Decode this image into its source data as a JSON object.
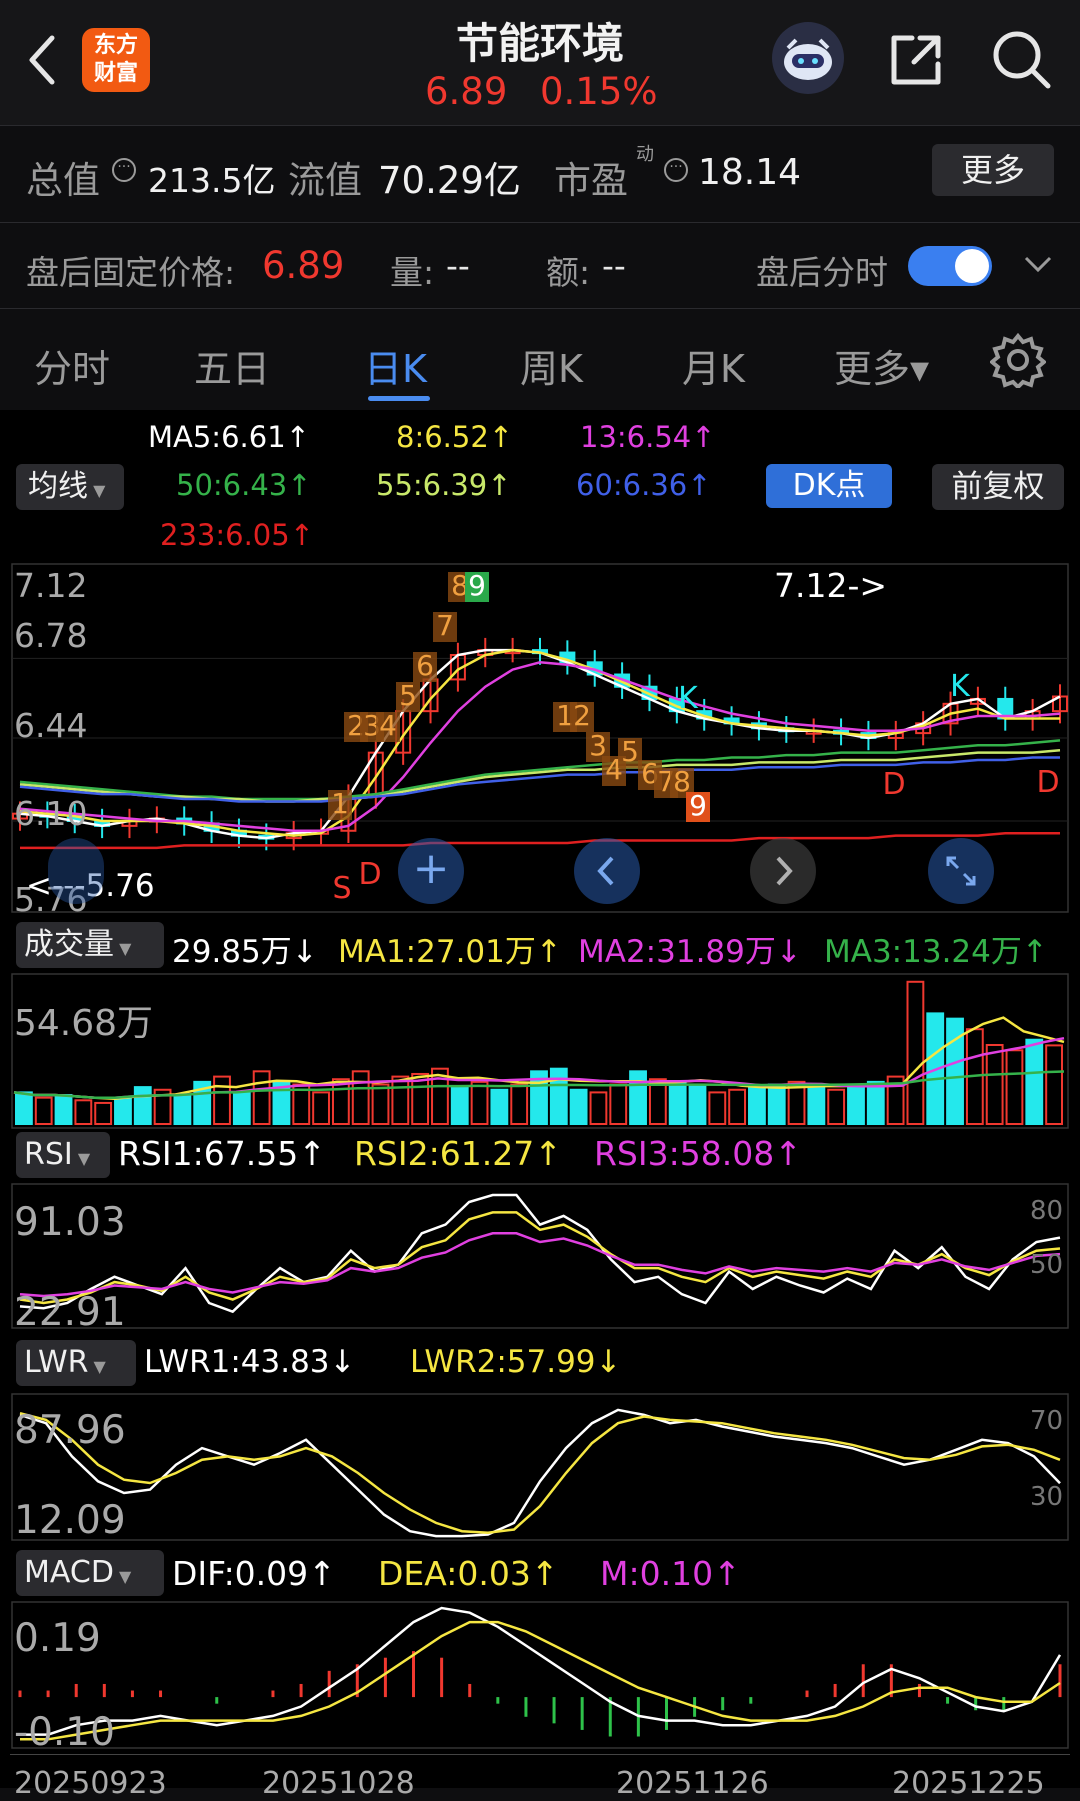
{
  "header": {
    "back_icon": "chevron-left-icon",
    "logo_line1": "东方",
    "logo_line2": "财富",
    "title": "节能环境",
    "price": "6.89",
    "change_pct": "0.15%",
    "icons": [
      "robot-avatar-icon",
      "share-icon",
      "search-icon"
    ]
  },
  "stats": {
    "total_label": "总值",
    "total_value": "213.5亿",
    "float_label": "流值",
    "float_value": "70.29亿",
    "pe_label": "市盈",
    "pe_sup": "动",
    "pe_value": "18.14",
    "more_button": "更多"
  },
  "after_hours": {
    "label": "盘后固定价格:",
    "price": "6.89",
    "vol_label": "量:",
    "vol_value": "--",
    "amt_label": "额:",
    "amt_value": "--",
    "toggle_label": "盘后分时",
    "toggle_on": true
  },
  "tabs": [
    "分时",
    "五日",
    "日K",
    "周K",
    "月K",
    "更多▾"
  ],
  "active_tab": "日K",
  "ma": {
    "selector": "均线",
    "ma5": "MA5:6.61↑",
    "ma8": "8:6.52↑",
    "ma13": "13:6.54↑",
    "ma50": "50:6.43↑",
    "ma55": "55:6.39↑",
    "ma60": "60:6.36↑",
    "ma233": "233:6.05↑",
    "dk_button": "DK点",
    "adjust_button": "前复权"
  },
  "kline": {
    "y_labels": [
      "7.12",
      "6.78",
      "6.44",
      "6.10",
      "5.76"
    ],
    "high_note": "7.12->",
    "low_note": "<---5.76",
    "td_up": [
      "1",
      "2",
      "3",
      "4",
      "5",
      "6",
      "7",
      "8",
      "9"
    ],
    "td_down": [
      "1",
      "2",
      "3",
      "4",
      "5",
      "6",
      "7",
      "8",
      "9"
    ],
    "markers": [
      "S",
      "D",
      "K",
      "K",
      "D",
      "D"
    ]
  },
  "volume": {
    "selector": "成交量",
    "value": "29.85万↓",
    "ma1": "MA1:27.01万↑",
    "ma2": "MA2:31.89万↓",
    "ma3": "MA3:13.24万↑",
    "y_label": "54.68万"
  },
  "rsi": {
    "selector": "RSI",
    "rsi1": "RSI1:67.55↑",
    "rsi2": "RSI2:61.27↑",
    "rsi3": "RSI3:58.08↑",
    "y_top": "91.03",
    "y_bottom": "22.91",
    "level_80": "80",
    "level_50": "50"
  },
  "lwr": {
    "selector": "LWR",
    "lwr1": "LWR1:43.83↓",
    "lwr2": "LWR2:57.99↓",
    "y_top": "87.96",
    "y_bottom": "12.09",
    "level_70": "70",
    "level_30": "30"
  },
  "macd": {
    "selector": "MACD",
    "dif": "DIF:0.09↑",
    "dea": "DEA:0.03↑",
    "m": "M:0.10↑",
    "y_top": "0.19",
    "y_bottom": "-0.10"
  },
  "dates": [
    "20250923",
    "20251028",
    "20251126",
    "20251225"
  ],
  "colors": {
    "up": "#f0382f",
    "down": "#24e8ec",
    "accent": "#4a8cf0",
    "ma5": "#ffffff",
    "ma8": "#f5e642",
    "ma13": "#e040e0",
    "ma50": "#35b24a",
    "ma55": "#c8e86a",
    "ma60": "#4060e8",
    "ma233": "#e02020"
  },
  "chart_data": [
    {
      "type": "line",
      "title": "",
      "y_range": [
        5.76,
        7.12
      ],
      "series": [
        {
          "name": "MA5",
          "values": [
            6.13,
            6.12,
            6.1,
            6.08,
            6.1,
            6.11,
            6.09,
            6.06,
            6.04,
            6.03,
            6.05,
            6.06,
            6.2,
            6.38,
            6.55,
            6.68,
            6.78,
            6.8,
            6.8,
            6.79,
            6.75,
            6.7,
            6.65,
            6.6,
            6.55,
            6.52,
            6.5,
            6.48,
            6.47,
            6.47,
            6.46,
            6.44,
            6.46,
            6.5,
            6.58,
            6.6,
            6.52,
            6.55,
            6.61
          ]
        },
        {
          "name": "8",
          "values": [
            6.14,
            6.13,
            6.12,
            6.1,
            6.1,
            6.1,
            6.09,
            6.08,
            6.06,
            6.05,
            6.04,
            6.05,
            6.12,
            6.28,
            6.45,
            6.6,
            6.72,
            6.78,
            6.8,
            6.79,
            6.76,
            6.72,
            6.67,
            6.62,
            6.57,
            6.53,
            6.5,
            6.49,
            6.48,
            6.47,
            6.46,
            6.45,
            6.46,
            6.49,
            6.54,
            6.56,
            6.52,
            6.52,
            6.52
          ]
        },
        {
          "name": "13",
          "values": [
            6.15,
            6.14,
            6.13,
            6.12,
            6.11,
            6.1,
            6.1,
            6.09,
            6.08,
            6.07,
            6.06,
            6.06,
            6.08,
            6.16,
            6.28,
            6.42,
            6.55,
            6.65,
            6.72,
            6.75,
            6.74,
            6.72,
            6.68,
            6.64,
            6.6,
            6.57,
            6.54,
            6.52,
            6.5,
            6.49,
            6.48,
            6.47,
            6.47,
            6.48,
            6.51,
            6.53,
            6.53,
            6.53,
            6.54
          ]
        },
        {
          "name": "50",
          "values": [
            6.26,
            6.25,
            6.24,
            6.23,
            6.22,
            6.21,
            6.2,
            6.2,
            6.19,
            6.19,
            6.19,
            6.19,
            6.2,
            6.21,
            6.23,
            6.25,
            6.27,
            6.29,
            6.3,
            6.31,
            6.32,
            6.33,
            6.34,
            6.34,
            6.35,
            6.35,
            6.36,
            6.36,
            6.37,
            6.37,
            6.38,
            6.38,
            6.38,
            6.39,
            6.4,
            6.41,
            6.41,
            6.42,
            6.43
          ]
        },
        {
          "name": "55",
          "values": [
            6.25,
            6.24,
            6.23,
            6.22,
            6.21,
            6.2,
            6.2,
            6.19,
            6.19,
            6.18,
            6.18,
            6.19,
            6.19,
            6.2,
            6.22,
            6.24,
            6.26,
            6.28,
            6.29,
            6.3,
            6.31,
            6.31,
            6.32,
            6.32,
            6.33,
            6.33,
            6.33,
            6.34,
            6.34,
            6.34,
            6.35,
            6.35,
            6.35,
            6.36,
            6.37,
            6.38,
            6.38,
            6.38,
            6.39
          ]
        },
        {
          "name": "60",
          "values": [
            6.24,
            6.23,
            6.22,
            6.21,
            6.21,
            6.2,
            6.19,
            6.19,
            6.18,
            6.18,
            6.18,
            6.18,
            6.19,
            6.2,
            6.21,
            6.23,
            6.25,
            6.26,
            6.27,
            6.28,
            6.29,
            6.29,
            6.3,
            6.3,
            6.31,
            6.31,
            6.31,
            6.32,
            6.32,
            6.32,
            6.33,
            6.33,
            6.33,
            6.34,
            6.34,
            6.35,
            6.35,
            6.36,
            6.36
          ]
        },
        {
          "name": "233",
          "values": [
            5.99,
            5.99,
            5.99,
            5.99,
            5.99,
            5.99,
            6.0,
            6.0,
            6.0,
            6.0,
            6.0,
            6.0,
            6.0,
            6.0,
            6.0,
            6.01,
            6.01,
            6.01,
            6.01,
            6.01,
            6.01,
            6.02,
            6.02,
            6.02,
            6.02,
            6.02,
            6.02,
            6.03,
            6.03,
            6.03,
            6.03,
            6.03,
            6.04,
            6.04,
            6.04,
            6.04,
            6.05,
            6.05,
            6.05
          ]
        }
      ]
    },
    {
      "type": "bar",
      "title": "成交量",
      "y_max": 54.68,
      "values": [
        12,
        10,
        11,
        9,
        8,
        10,
        14,
        13,
        11,
        16,
        18,
        12,
        20,
        16,
        15,
        12,
        17,
        20,
        15,
        18,
        19,
        21,
        14,
        16,
        13,
        15,
        20,
        21,
        13,
        12,
        15,
        20,
        17,
        16,
        15,
        12,
        13,
        14,
        15,
        16,
        14,
        13,
        15,
        16,
        18,
        54,
        42,
        40,
        36,
        30,
        28,
        32,
        29.85
      ],
      "up": [
        0,
        1,
        0,
        1,
        1,
        0,
        0,
        1,
        0,
        0,
        1,
        0,
        1,
        0,
        1,
        1,
        1,
        1,
        1,
        1,
        1,
        1,
        0,
        1,
        0,
        1,
        0,
        0,
        0,
        1,
        1,
        0,
        1,
        0,
        0,
        1,
        1,
        0,
        0,
        1,
        0,
        1,
        0,
        0,
        1,
        1,
        0,
        0,
        1,
        1,
        1,
        0,
        1
      ]
    },
    {
      "type": "line",
      "title": "RSI",
      "y_range": [
        22.91,
        91.03
      ],
      "series": [
        {
          "name": "RSI1",
          "values": [
            28,
            27,
            30,
            38,
            45,
            40,
            35,
            50,
            30,
            25,
            38,
            50,
            42,
            45,
            60,
            48,
            52,
            70,
            75,
            88,
            92,
            92,
            75,
            80,
            72,
            55,
            42,
            45,
            35,
            30,
            48,
            38,
            45,
            40,
            36,
            44,
            38,
            60,
            50,
            62,
            45,
            38,
            55,
            65,
            67.55
          ]
        },
        {
          "name": "RSI2",
          "values": [
            32,
            30,
            32,
            36,
            42,
            40,
            37,
            45,
            36,
            32,
            38,
            45,
            42,
            44,
            55,
            50,
            52,
            62,
            66,
            78,
            82,
            82,
            72,
            75,
            68,
            58,
            50,
            50,
            45,
            42,
            50,
            45,
            48,
            46,
            44,
            48,
            45,
            55,
            52,
            58,
            50,
            46,
            54,
            60,
            61.27
          ]
        },
        {
          "name": "RSI3",
          "values": [
            35,
            34,
            35,
            37,
            40,
            39,
            38,
            42,
            38,
            36,
            39,
            42,
            41,
            43,
            50,
            48,
            50,
            56,
            59,
            66,
            70,
            70,
            65,
            67,
            63,
            57,
            52,
            52,
            49,
            47,
            51,
            48,
            50,
            49,
            48,
            50,
            48,
            53,
            52,
            55,
            51,
            49,
            53,
            57,
            58.08
          ]
        }
      ]
    },
    {
      "type": "line",
      "title": "LWR",
      "y_range": [
        12.09,
        87.96
      ],
      "series": [
        {
          "name": "LWR1",
          "values": [
            85,
            80,
            60,
            45,
            38,
            40,
            55,
            65,
            60,
            55,
            62,
            70,
            55,
            40,
            25,
            15,
            12,
            12,
            13,
            20,
            45,
            65,
            80,
            88,
            85,
            80,
            82,
            78,
            75,
            72,
            70,
            68,
            65,
            60,
            55,
            58,
            64,
            70,
            68,
            60,
            43.83
          ]
        },
        {
          "name": "LWR2",
          "values": [
            86,
            82,
            70,
            55,
            46,
            44,
            50,
            58,
            60,
            58,
            60,
            65,
            60,
            50,
            38,
            28,
            20,
            15,
            14,
            16,
            30,
            50,
            68,
            80,
            84,
            82,
            81,
            80,
            77,
            74,
            72,
            70,
            67,
            63,
            59,
            58,
            61,
            66,
            67,
            64,
            57.99
          ]
        }
      ]
    },
    {
      "type": "line",
      "title": "MACD",
      "y_range": [
        -0.1,
        0.19
      ],
      "series": [
        {
          "name": "DIF",
          "values": [
            -0.08,
            -0.08,
            -0.06,
            -0.05,
            -0.05,
            -0.04,
            -0.05,
            -0.06,
            -0.05,
            -0.04,
            -0.02,
            0.02,
            0.06,
            0.11,
            0.16,
            0.19,
            0.18,
            0.15,
            0.11,
            0.07,
            0.03,
            -0.01,
            -0.04,
            -0.05,
            -0.05,
            -0.06,
            -0.06,
            -0.05,
            -0.04,
            -0.02,
            0.03,
            0.06,
            0.04,
            0.01,
            -0.02,
            -0.03,
            -0.01,
            0.09
          ]
        },
        {
          "name": "DEA",
          "values": [
            -0.09,
            -0.09,
            -0.08,
            -0.07,
            -0.06,
            -0.05,
            -0.05,
            -0.05,
            -0.05,
            -0.05,
            -0.04,
            -0.02,
            0.01,
            0.05,
            0.09,
            0.13,
            0.16,
            0.16,
            0.14,
            0.11,
            0.08,
            0.05,
            0.02,
            0.0,
            -0.02,
            -0.04,
            -0.05,
            -0.05,
            -0.05,
            -0.04,
            -0.02,
            0.01,
            0.02,
            0.02,
            0.0,
            -0.01,
            -0.01,
            0.03
          ]
        },
        {
          "name": "M",
          "values": [
            0.02,
            0.02,
            0.04,
            0.04,
            0.02,
            0.02,
            0.0,
            -0.02,
            0.0,
            0.02,
            0.04,
            0.08,
            0.1,
            0.12,
            0.14,
            0.12,
            0.04,
            -0.02,
            -0.06,
            -0.08,
            -0.1,
            -0.12,
            -0.12,
            -0.1,
            -0.06,
            -0.04,
            -0.02,
            0.0,
            0.02,
            0.04,
            0.1,
            0.1,
            0.04,
            -0.02,
            -0.04,
            -0.04,
            0.0,
            0.1
          ]
        }
      ]
    }
  ]
}
